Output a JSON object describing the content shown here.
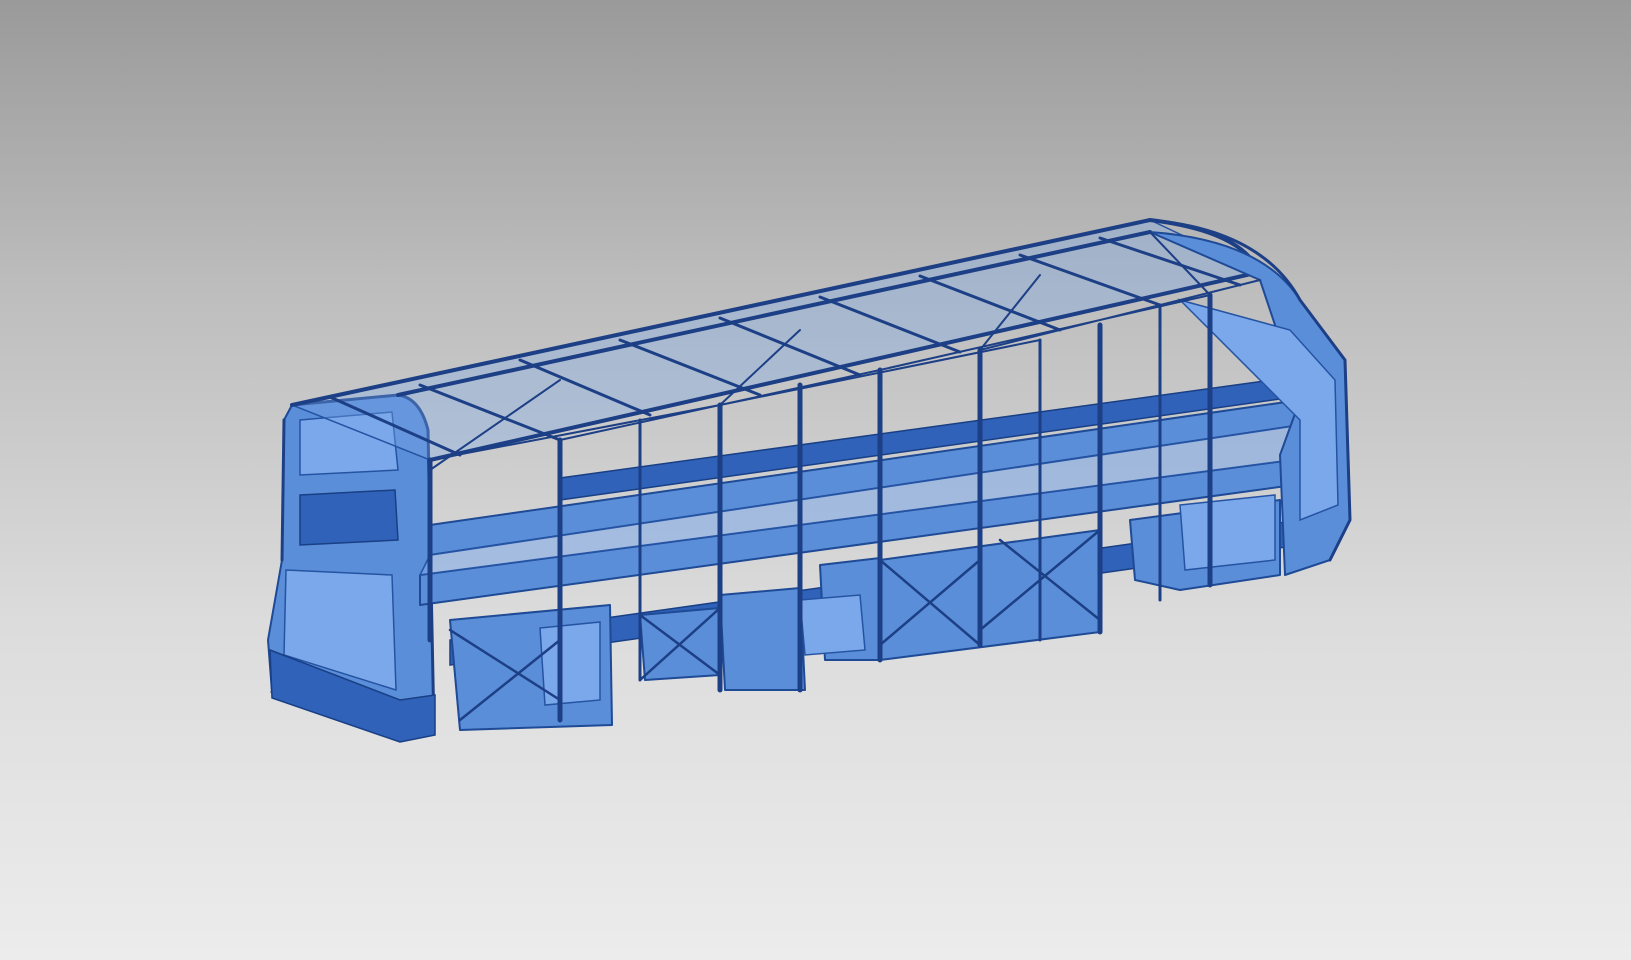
{
  "scene": {
    "subject": "bus-body-frame",
    "colors": {
      "background_top": "#9a9a9a",
      "background_bottom": "#ececec",
      "frame_fill": "#5b8ed8",
      "frame_stroke": "#1c3f86",
      "frame_highlight": "#8cb6f0",
      "frame_shadow": "#2a5cb4"
    }
  }
}
